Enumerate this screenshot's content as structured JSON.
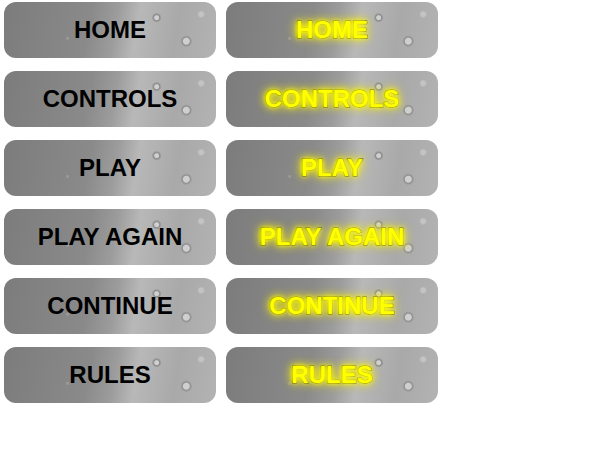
{
  "rows": [
    [
      {
        "label": "HOME",
        "highlighted": false
      },
      {
        "label": "HOME",
        "highlighted": true
      }
    ],
    [
      {
        "label": "CONTROLS",
        "highlighted": false
      },
      {
        "label": "CONTROLS",
        "highlighted": true
      }
    ],
    [
      {
        "label": "PLAY",
        "highlighted": false
      },
      {
        "label": "PLAY",
        "highlighted": true
      }
    ],
    [
      {
        "label": "PLAY AGAIN",
        "highlighted": false
      },
      {
        "label": "PLAY AGAIN",
        "highlighted": true
      }
    ],
    [
      {
        "label": "CONTINUE",
        "highlighted": false
      },
      {
        "label": "CONTINUE",
        "highlighted": true
      }
    ],
    [
      {
        "label": "RULES",
        "highlighted": false
      },
      {
        "label": "RULES",
        "highlighted": true
      }
    ]
  ]
}
